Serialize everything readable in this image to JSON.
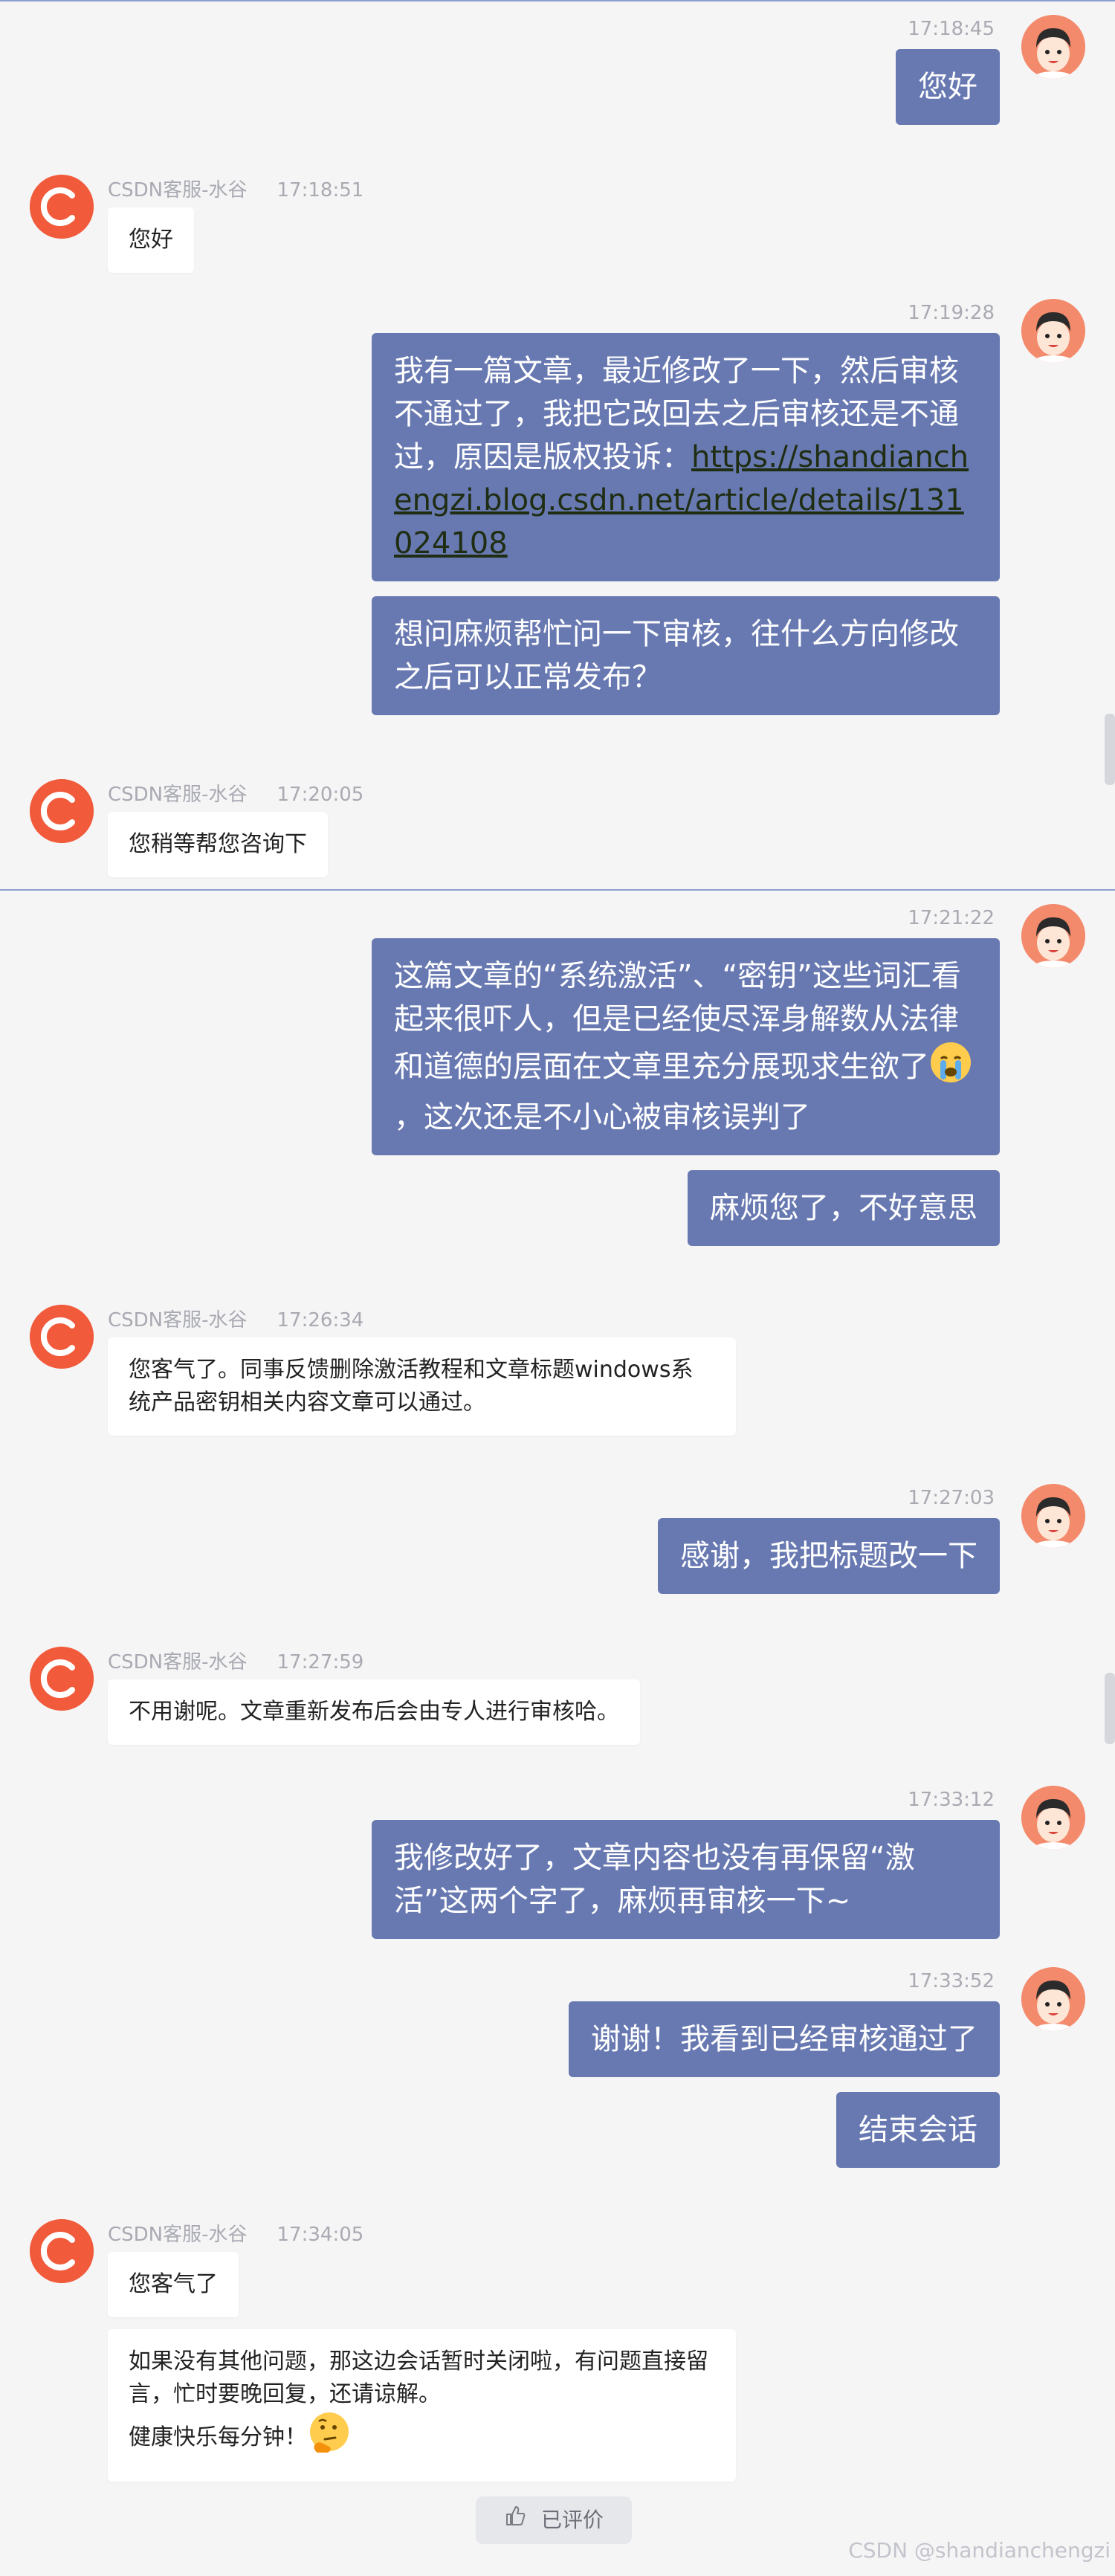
{
  "conversation": {
    "user_msg_1": {
      "time": "17:18:45",
      "bubbles": [
        "您好"
      ]
    },
    "agent_msg_1": {
      "name": "CSDN客服-水谷",
      "time": "17:18:51",
      "bubbles": [
        "您好"
      ]
    },
    "user_msg_2": {
      "time": "17:19:28",
      "bubble_1_text": "我有一篇文章，最近修改了一下，然后审核不通过了，我把它改回去之后审核还是不通过，原因是版权投诉：",
      "bubble_1_link": "https://shandianchengzi.blog.csdn.net/article/details/131024108",
      "bubble_2": "想问麻烦帮忙问一下审核，往什么方向修改之后可以正常发布？"
    },
    "agent_msg_2": {
      "name": "CSDN客服-水谷",
      "time": "17:20:05",
      "bubbles": [
        "您稍等帮您咨询下"
      ]
    },
    "user_msg_3": {
      "time": "17:21:22",
      "bubble_1_text": "这篇文章的“系统激活”、“密钥”这些词汇看起来很吓人，但是已经使尽浑身解数从法律和道德的层面在文章里充分展现求生欲了",
      "bubble_1_emoji": "crying-face",
      "bubble_1_tail": "，这次还是不小心被审核误判了",
      "bubble_2": "麻烦您了，不好意思"
    },
    "agent_msg_3": {
      "name": "CSDN客服-水谷",
      "time": "17:26:34",
      "bubbles": [
        "您客气了。同事反馈删除激活教程和文章标题windows系统产品密钥相关内容文章可以通过。"
      ]
    },
    "user_msg_4": {
      "time": "17:27:03",
      "bubbles": [
        "感谢，我把标题改一下"
      ]
    },
    "agent_msg_4": {
      "name": "CSDN客服-水谷",
      "time": "17:27:59",
      "bubbles": [
        "不用谢呢。文章重新发布后会由专人进行审核哈。"
      ]
    },
    "user_msg_5": {
      "time": "17:33:12",
      "bubbles": [
        "我修改好了，文章内容也没有再保留“激活”这两个字了，麻烦再审核一下~"
      ]
    },
    "user_msg_6": {
      "time": "17:33:52",
      "bubbles": [
        "谢谢！我看到已经审核通过了",
        "结束会话"
      ]
    },
    "agent_msg_5": {
      "name": "CSDN客服-水谷",
      "time": "17:34:05",
      "bubble_1": "您客气了",
      "bubble_2_text": "如果没有其他问题，那这边会话暂时关闭啦，有问题直接留言，忙时要晚回复，还请谅解。",
      "bubble_2_line2": "健康快乐每分钟！",
      "bubble_2_emoji": "thinking-face"
    }
  },
  "rating": {
    "label": "已评价",
    "icon": "thumbs-up-icon"
  },
  "watermark": "CSDN @shandianchengzi",
  "colors": {
    "user_bubble": "#6879b2",
    "agent_bubble": "#ffffff",
    "agent_avatar": "#f15a3a",
    "user_avatar": "#f48a6c",
    "background": "#f5f5f6",
    "divider": "#8e9fd0"
  }
}
